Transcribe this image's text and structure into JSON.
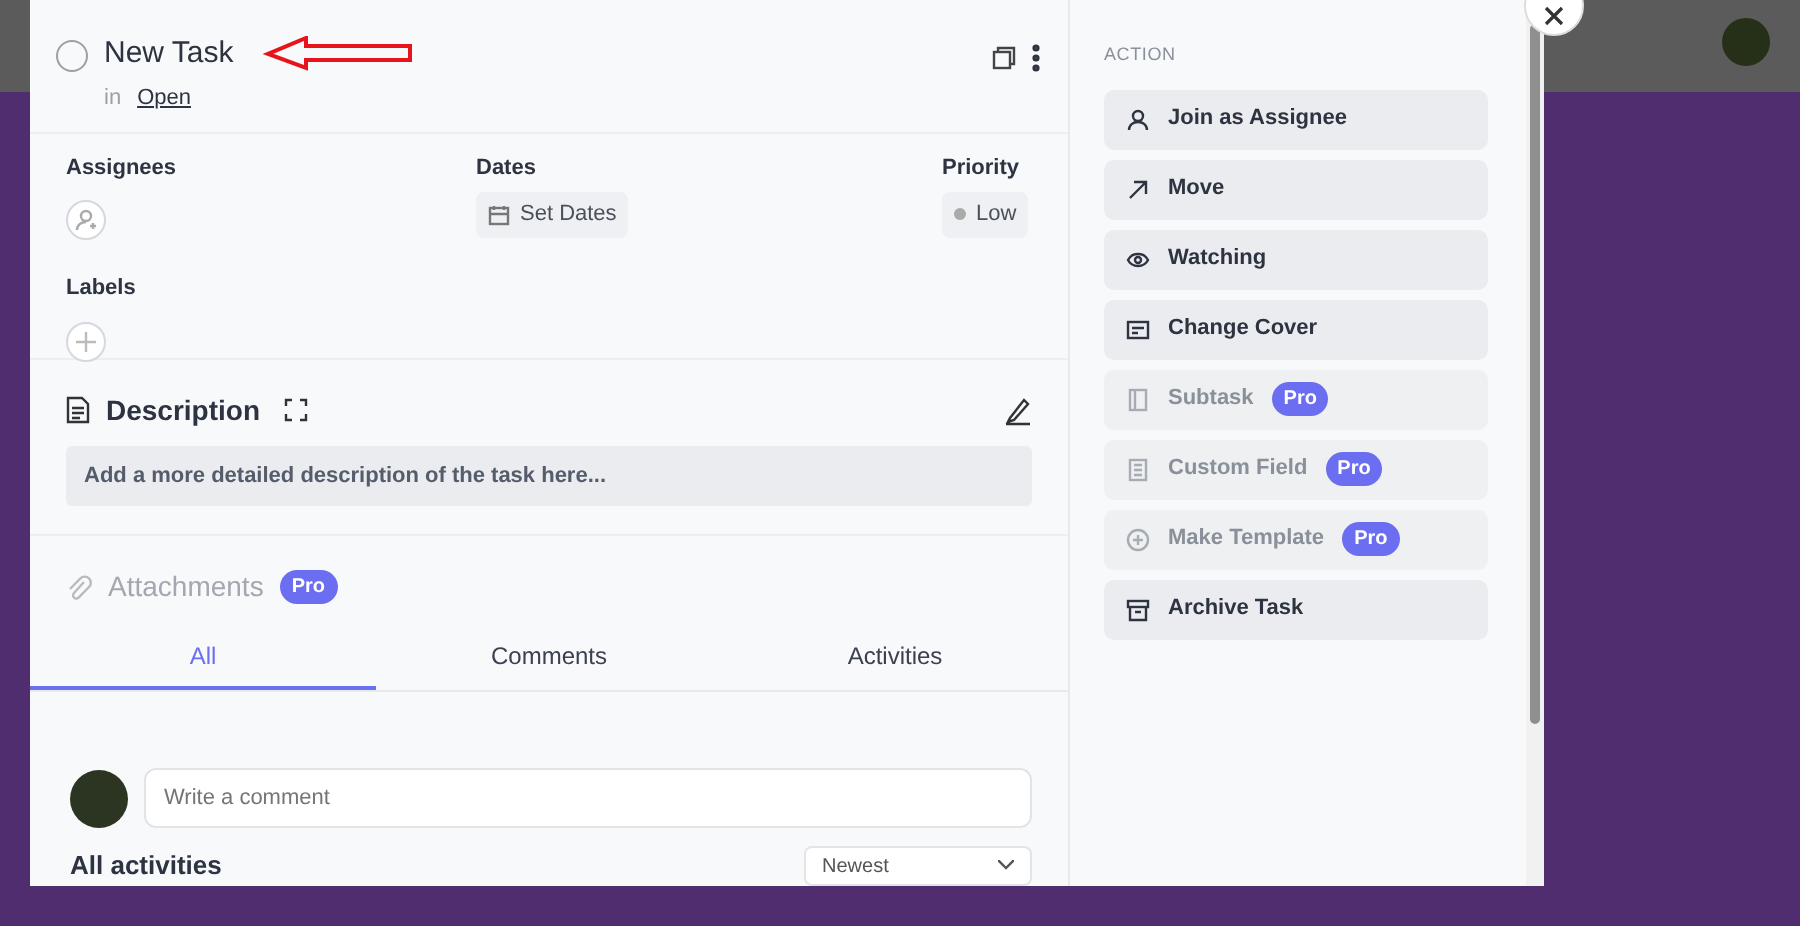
{
  "task": {
    "title": "New Task",
    "completed": false,
    "location_prefix": "in",
    "location": "Open"
  },
  "fields": {
    "assignees_label": "Assignees",
    "dates_label": "Dates",
    "dates_button": "Set Dates",
    "priority_label": "Priority",
    "priority": "Low",
    "labels_label": "Labels"
  },
  "description": {
    "title": "Description",
    "placeholder": "Add a more detailed description of the task here..."
  },
  "attachments": {
    "title": "Attachments",
    "badge": "Pro"
  },
  "tabs": [
    {
      "label": "All",
      "selected": true
    },
    {
      "label": "Comments",
      "selected": false
    },
    {
      "label": "Activities",
      "selected": false
    }
  ],
  "comment": {
    "placeholder": "Write a comment"
  },
  "activities": {
    "title": "All activities",
    "sort": "Newest"
  },
  "sidebar": {
    "heading": "ACTION",
    "actions": [
      {
        "kind": "person",
        "label": "Join as Assignee",
        "disabled": false
      },
      {
        "kind": "arrow",
        "label": "Move",
        "disabled": false
      },
      {
        "kind": "eye",
        "label": "Watching",
        "disabled": false
      },
      {
        "kind": "cover",
        "label": "Change Cover",
        "disabled": false
      },
      {
        "kind": "subtask",
        "label": "Subtask",
        "disabled": true,
        "badge": "Pro"
      },
      {
        "kind": "field",
        "label": "Custom Field",
        "disabled": true,
        "badge": "Pro"
      },
      {
        "kind": "template",
        "label": "Make Template",
        "disabled": true,
        "badge": "Pro"
      },
      {
        "kind": "archive",
        "label": "Archive Task",
        "disabled": false
      }
    ]
  }
}
